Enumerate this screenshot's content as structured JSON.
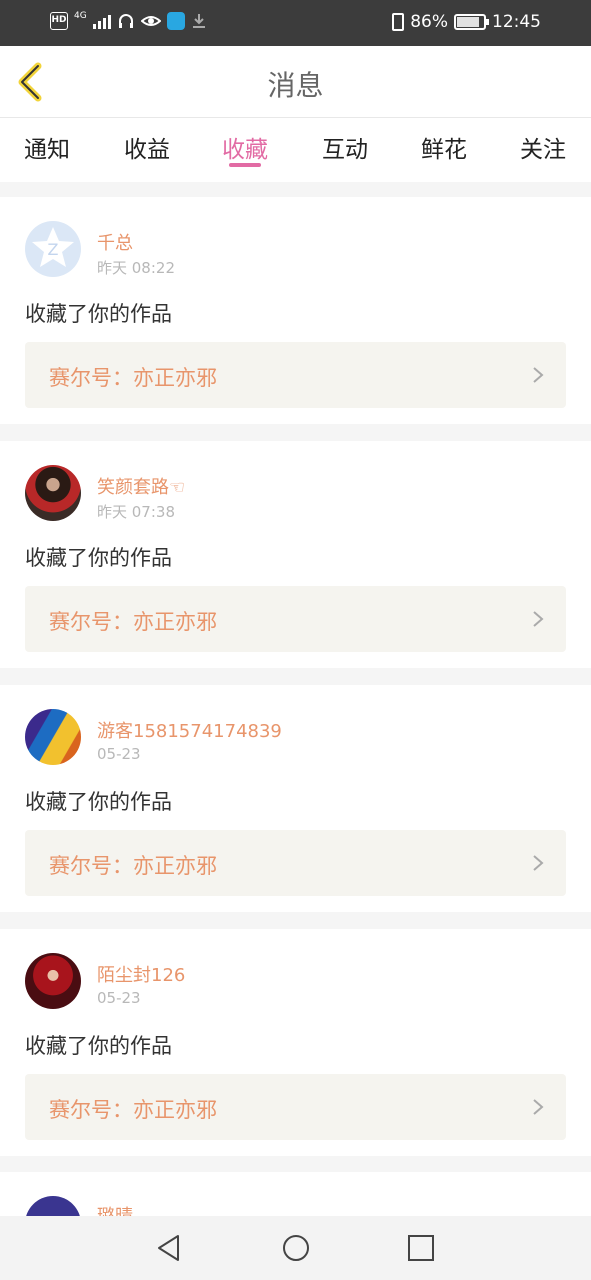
{
  "status_bar": {
    "hd": "HD",
    "network": "4G",
    "battery": "86%",
    "battery_level": 0.86,
    "time": "12:45"
  },
  "header": {
    "title": "消息"
  },
  "tabs": [
    "通知",
    "收益",
    "收藏",
    "互动",
    "鲜花",
    "关注"
  ],
  "active_tab": "收藏",
  "accent_color": "#e26ba4",
  "name_color": "#e8956b",
  "notifications": [
    {
      "user": "千总",
      "time": "昨天 08:22",
      "action": "收藏了你的作品",
      "work": "赛尔号：亦正亦邪",
      "avatar": "qq-default-avatar"
    },
    {
      "user": "笑颜套路☜",
      "time": "昨天 07:38",
      "action": "收藏了你的作品",
      "work": "赛尔号：亦正亦邪",
      "avatar": "user-photo-avatar"
    },
    {
      "user": "游客1581574174839",
      "time": "05-23",
      "action": "收藏了你的作品",
      "work": "赛尔号：亦正亦邪",
      "avatar": "anime-avatar-blue-yellow"
    },
    {
      "user": "陌尘封126",
      "time": "05-23",
      "action": "收藏了你的作品",
      "work": "赛尔号：亦正亦邪",
      "avatar": "anime-avatar-red"
    },
    {
      "user": "璐晴",
      "avatar": "anime-avatar-purple"
    }
  ]
}
